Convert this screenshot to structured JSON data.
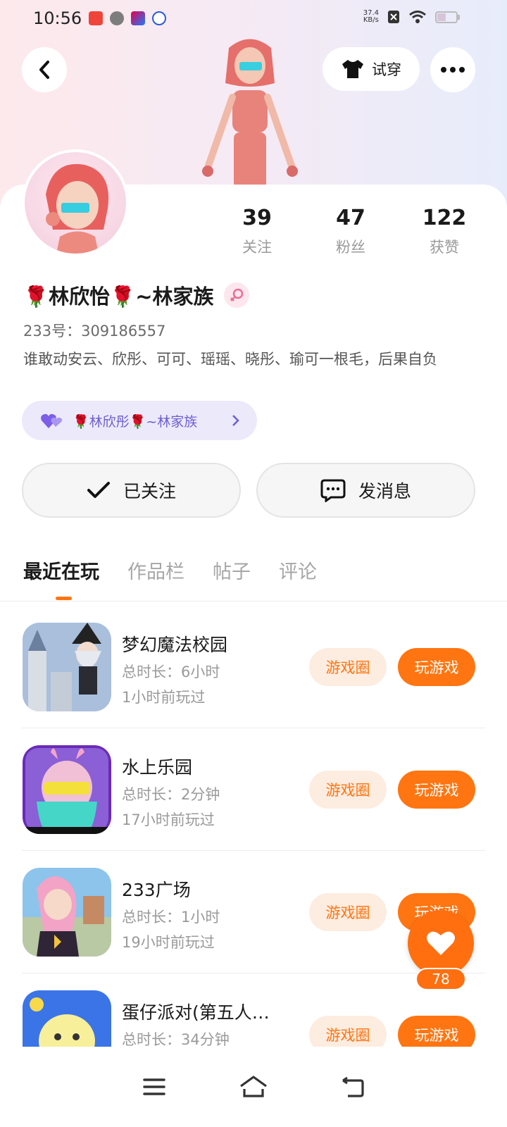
{
  "status_bar": {
    "time": "10:56",
    "net_speed_value": "37.4",
    "net_speed_unit": "KB/s"
  },
  "header": {
    "try_on_label": "试穿"
  },
  "profile": {
    "stats": [
      {
        "num": "39",
        "label": "关注"
      },
      {
        "num": "47",
        "label": "粉丝"
      },
      {
        "num": "122",
        "label": "获赞"
      }
    ],
    "name": "🌹林欣怡🌹~林家族",
    "uid": "233号：309186557",
    "bio": "谁敢动安云、欣彤、可可、瑶瑶、晓彤、瑜可一根毛，后果自负",
    "family": "🌹林欣彤🌹~林家族"
  },
  "actions": {
    "follow_label": "已关注",
    "message_label": "发消息"
  },
  "tabs": [
    "最近在玩",
    "作品栏",
    "帖子",
    "评论"
  ],
  "games": [
    {
      "title": "梦幻魔法校园",
      "duration": "总时长：6小时",
      "last_played": "1小时前玩过",
      "circle_label": "游戏圈",
      "play_label": "玩游戏"
    },
    {
      "title": "水上乐园",
      "duration": "总时长：2分钟",
      "last_played": "17小时前玩过",
      "circle_label": "游戏圈",
      "play_label": "玩游戏"
    },
    {
      "title": "233广场",
      "duration": "总时长：1小时",
      "last_played": "19小时前玩过",
      "circle_label": "游戏圈",
      "play_label": "玩游戏"
    },
    {
      "title": "蛋仔派对(第五人…",
      "duration": "总时长：34分钟",
      "last_played": "",
      "circle_label": "游戏圈",
      "play_label": "玩游戏"
    }
  ],
  "like_fab": {
    "count": "78"
  },
  "colors": {
    "accent": "#ff7511",
    "accent_soft": "#fdece0",
    "family_bg": "#ece9fb",
    "family_text": "#6c5fd0"
  }
}
